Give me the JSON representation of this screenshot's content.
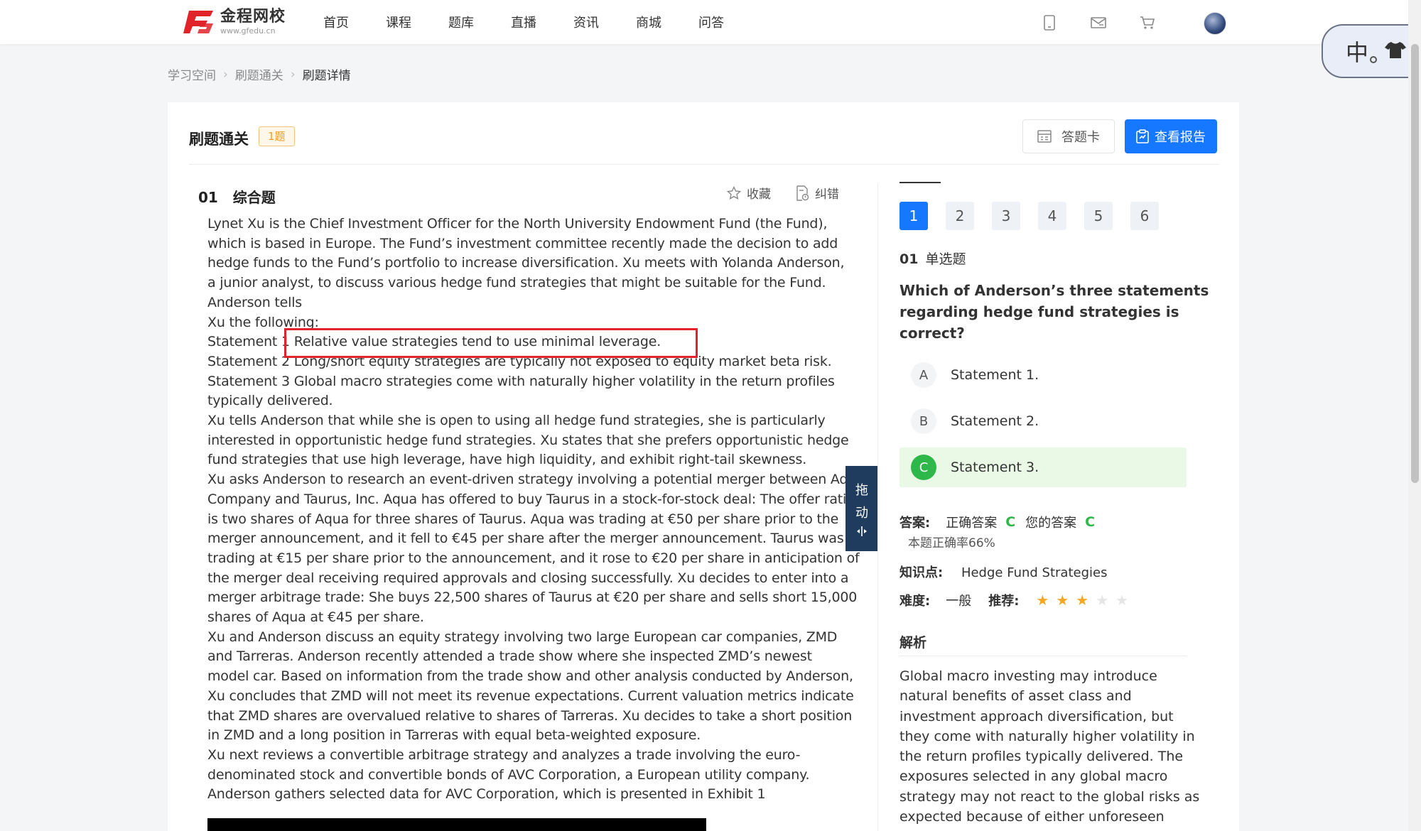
{
  "brand": {
    "name_cn": "金程网校",
    "domain": "www.gfedu.cn",
    "red": "#e0242a",
    "blue": "#1677ff",
    "green": "#2fb84a"
  },
  "nav": [
    "首页",
    "课程",
    "题库",
    "直播",
    "资讯",
    "商城",
    "问答"
  ],
  "top_icons": [
    "mobile-icon",
    "mail-icon",
    "cart-icon"
  ],
  "ime": {
    "label": "中"
  },
  "breadcrumb": [
    "学习空间",
    "刷题通关",
    "刷题详情"
  ],
  "header": {
    "title": "刷题通关",
    "count_badge": "1题",
    "card_button": "答题卡",
    "report_button": "查看报告"
  },
  "question": {
    "number": "01",
    "type": "综合题",
    "favorite": "收藏",
    "report_error": "纠错",
    "lines": [
      "Lynet Xu is the Chief Investment Officer for the North University Endowment Fund (the Fund),",
      "which is based in Europe. The Fund’s investment committee recently made the decision to add",
      "hedge funds to the Fund’s portfolio to increase diversification. Xu meets with Yolanda Anderson,",
      "a junior analyst, to discuss various hedge fund strategies that might be suitable for the Fund.",
      "Anderson tells",
      "Xu the following:",
      "Statement 1 Relative value strategies tend to use minimal leverage.",
      "Statement 2 Long/short equity strategies are typically not exposed to equity market beta risk.",
      "Statement 3 Global macro strategies come with naturally higher volatility in the return profiles",
      "typically delivered.",
      "Xu tells Anderson that while she is open to using all hedge fund strategies, she is particularly",
      "interested in opportunistic hedge fund strategies. Xu states that she prefers opportunistic hedge",
      "fund strategies that use high leverage, have high liquidity, and exhibit right-tail skewness.",
      "Xu asks Anderson to research an event-driven strategy involving a potential merger between Aqua",
      "Company and Taurus, Inc. Aqua has offered to buy Taurus in a stock-for-stock deal: The offer ratio",
      "is two shares of Aqua for three shares of Taurus. Aqua was trading at €50 per share prior to the",
      "merger announcement, and it fell to €45 per share after the merger announcement. Taurus was",
      "trading at €15 per share prior to the announcement, and it rose to €20 per share in anticipation of",
      "the merger deal receiving required approvals and closing successfully. Xu decides to enter into a",
      "merger arbitrage trade: She buys 22,500 shares of Taurus at €20 per share and sells short 15,000",
      "shares of Aqua at €45 per share.",
      "Xu and Anderson discuss an equity strategy involving two large European car companies, ZMD",
      "and Tarreras. Anderson recently attended a trade show where she inspected ZMD’s newest",
      "model car. Based on information from the trade show and other analysis conducted by Anderson,",
      "Xu concludes that ZMD will not meet its revenue expectations. Current valuation metrics indicate",
      "that ZMD shares are overvalued relative to shares of Tarreras. Xu decides to take a short position",
      "in ZMD and a long position in Tarreras with equal beta-weighted exposure.",
      "Xu next reviews a convertible arbitrage strategy and analyzes a trade involving the euro-",
      "denominated stock and convertible bonds of AVC Corporation, a European utility company.",
      "Anderson gathers selected data for AVC Corporation, which is presented in Exhibit 1"
    ]
  },
  "drag_handle": {
    "line1": "拖",
    "line2": "动"
  },
  "answer_sheet": {
    "numbers": [
      "1",
      "2",
      "3",
      "4",
      "5",
      "6"
    ],
    "active_index": 0
  },
  "sub_question": {
    "number": "01",
    "type": "单选题",
    "stem_lines": [
      "Which of Anderson’s three statements",
      "regarding hedge fund strategies is",
      "correct?"
    ],
    "options": [
      {
        "letter": "A",
        "text": "Statement 1.",
        "correct": false
      },
      {
        "letter": "B",
        "text": "Statement 2.",
        "correct": false
      },
      {
        "letter": "C",
        "text": "Statement 3.",
        "correct": true
      }
    ],
    "answer_label": "答案:",
    "correct_label": "正确答案",
    "correct_value": "C",
    "your_label": "您的答案",
    "your_value": "C",
    "accuracy": "本题正确率66%",
    "knowledge_label": "知识点:",
    "knowledge_value": "Hedge Fund Strategies",
    "difficulty_label": "难度:",
    "difficulty_value": "一般",
    "recommend_label": "推荐:",
    "recommend_stars": 3,
    "recommend_max": 5,
    "analysis_title": "解析",
    "analysis_lines": [
      "Global macro investing may introduce",
      "natural benefits of asset class and",
      "investment approach diversification, but",
      "they come with naturally higher volatility in",
      "the return profiles typically delivered. The",
      "exposures selected in any global macro",
      "strategy may not react to the global risks as",
      "expected because of either unforeseen"
    ]
  }
}
